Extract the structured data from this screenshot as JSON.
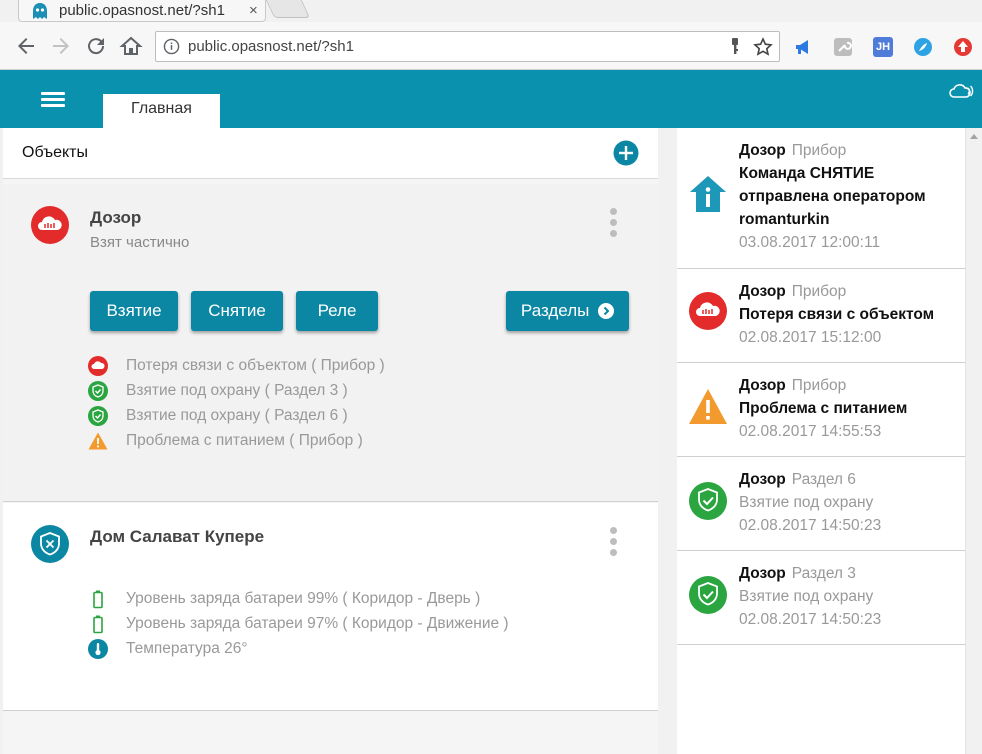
{
  "browser": {
    "tab_title": "public.opasnost.net/?sh1",
    "tab_close": "×",
    "address": "public.opasnost.net/?sh1",
    "extensions": [
      {
        "icon": "bullhorn-icon",
        "color": "#2d7be0"
      },
      {
        "icon": "wrench-icon",
        "color": "#9e9e9e"
      },
      {
        "icon": "jh-icon",
        "label": "JH",
        "color": "#4f7bd9"
      },
      {
        "icon": "feather-icon",
        "color": "#2ea3e3"
      },
      {
        "icon": "up-arrow-icon",
        "color": "#e53935"
      }
    ]
  },
  "header": {
    "tab_main": "Главная",
    "accent": "#0991ad"
  },
  "objects_panel": {
    "title": "Объекты"
  },
  "cards": [
    {
      "name": "Дозор",
      "status": "Взят частично",
      "buttons": {
        "arm": "Взятие",
        "disarm": "Снятие",
        "relay": "Реле",
        "partitions": "Разделы"
      },
      "events": [
        {
          "icon": "cloud-lost-icon",
          "text": "Потеря связи с объектом ( Прибор )"
        },
        {
          "icon": "shield-check-icon",
          "text": "Взятие под охрану ( Раздел 3 )"
        },
        {
          "icon": "shield-check-icon",
          "text": "Взятие под охрану ( Раздел 6 )"
        },
        {
          "icon": "warning-icon",
          "text": "Проблема с питанием ( Прибор )"
        }
      ]
    },
    {
      "name": "Дом Салават Купере",
      "status": "",
      "events": [
        {
          "icon": "battery-icon",
          "text": "Уровень заряда батареи 99% ( Коридор - Дверь )"
        },
        {
          "icon": "battery-icon",
          "text": "Уровень заряда батареи 97% ( Коридор - Движение )"
        },
        {
          "icon": "thermometer-icon",
          "text": "Температура 26°"
        }
      ]
    }
  ],
  "feed": [
    {
      "icon": "info-icon",
      "object": "Дозор",
      "source": "Прибор",
      "message": "Команда СНЯТИЕ отправлена оператором romanturkin",
      "bold": true,
      "time": "03.08.2017 12:00:11"
    },
    {
      "icon": "cloud-lost-icon",
      "object": "Дозор",
      "source": "Прибор",
      "message": "Потеря связи с объектом",
      "bold": true,
      "time": "02.08.2017 15:12:00"
    },
    {
      "icon": "warning-icon",
      "object": "Дозор",
      "source": "Прибор",
      "message": "Проблема с питанием",
      "bold": true,
      "time": "02.08.2017 14:55:53"
    },
    {
      "icon": "shield-check-icon",
      "object": "Дозор",
      "source": "Раздел 6",
      "message": "Взятие под охрану",
      "bold": false,
      "time": "02.08.2017 14:50:23"
    },
    {
      "icon": "shield-check-icon",
      "object": "Дозор",
      "source": "Раздел 3",
      "message": "Взятие под охрану",
      "bold": false,
      "time": "02.08.2017 14:50:23"
    }
  ]
}
